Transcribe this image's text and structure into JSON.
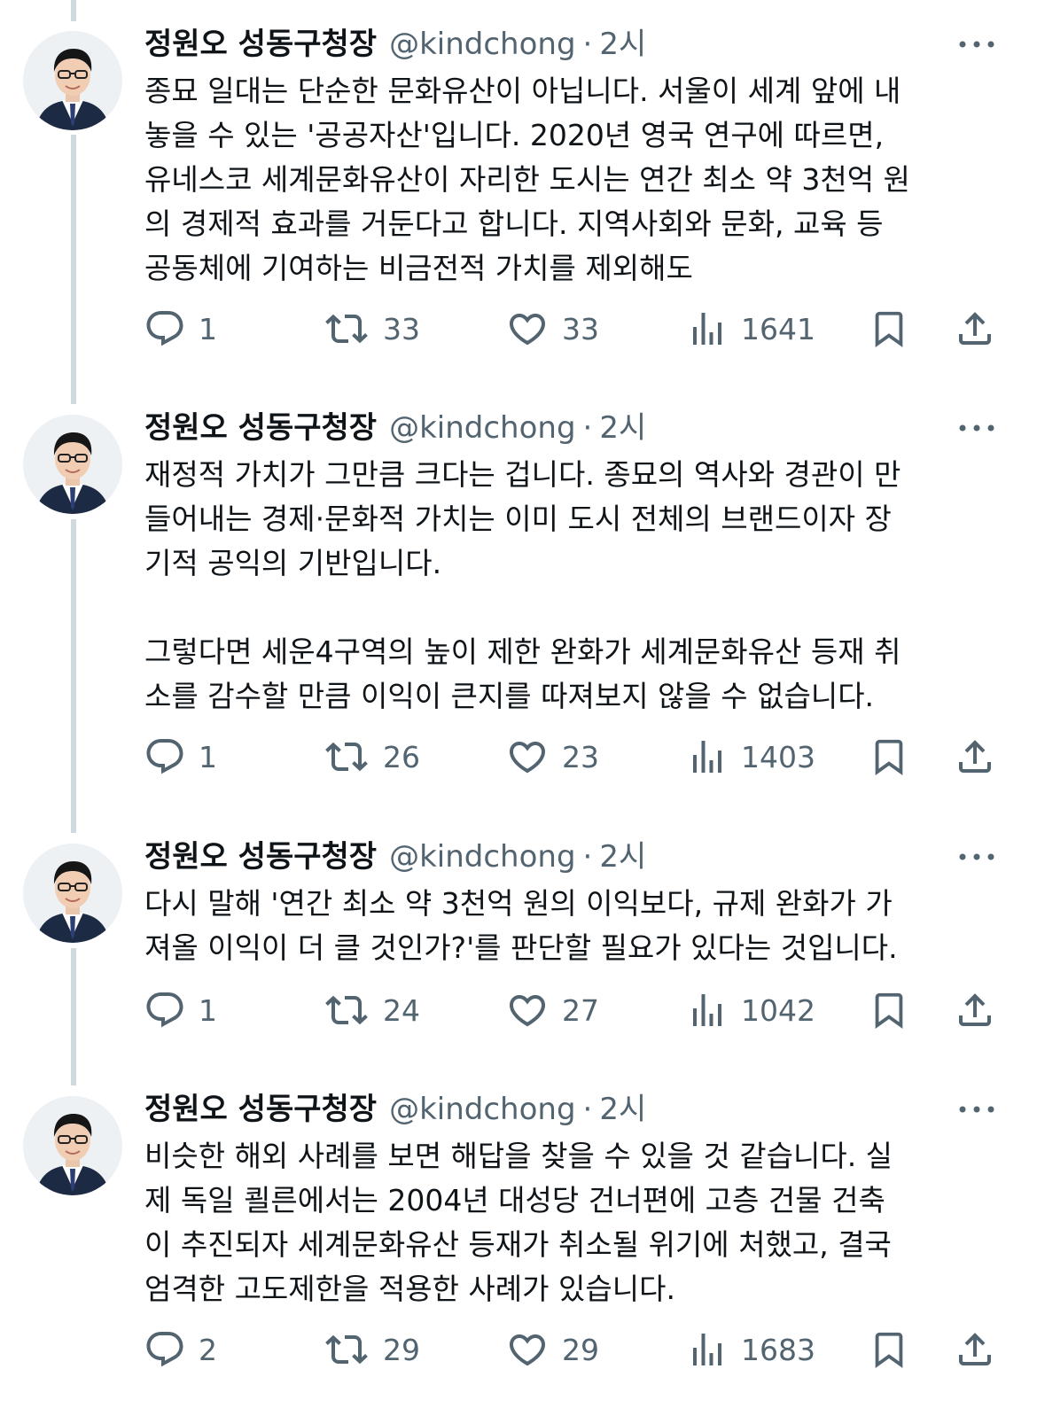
{
  "tweets": [
    {
      "author_name": "정원오 성동구청장",
      "author_handle": "@kindchong",
      "separator": "·",
      "time": "2시",
      "text": "종묘 일대는 단순한 문화유산이 아닙니다. 서울이 세계 앞에 내\n놓을 수 있는 '공공자산'입니다. 2020년 영국 연구에 따르면,\n유네스코 세계문화유산이 자리한 도시는 연간 최소 약 3천억 원\n의 경제적 효과를 거둔다고 합니다. 지역사회와 문화, 교육 등\n공동체에 기여하는 비금전적 가치를 제외해도",
      "replies": "1",
      "retweets": "33",
      "likes": "33",
      "views": "1641"
    },
    {
      "author_name": "정원오 성동구청장",
      "author_handle": "@kindchong",
      "separator": "·",
      "time": "2시",
      "text": "재정적 가치가 그만큼 크다는 겁니다. 종묘의 역사와 경관이 만\n들어내는 경제·문화적 가치는 이미 도시 전체의 브랜드이자 장\n기적 공익의 기반입니다.\n\n그렇다면 세운4구역의 높이 제한 완화가 세계문화유산 등재 취\n소를 감수할 만큼 이익이 큰지를 따져보지 않을 수 없습니다.",
      "replies": "1",
      "retweets": "26",
      "likes": "23",
      "views": "1403"
    },
    {
      "author_name": "정원오 성동구청장",
      "author_handle": "@kindchong",
      "separator": "·",
      "time": "2시",
      "text": "다시 말해 '연간 최소 약 3천억 원의 이익보다, 규제 완화가 가\n져올 이익이 더 클 것인가?'를 판단할 필요가 있다는 것입니다.",
      "replies": "1",
      "retweets": "24",
      "likes": "27",
      "views": "1042"
    },
    {
      "author_name": "정원오 성동구청장",
      "author_handle": "@kindchong",
      "separator": "·",
      "time": "2시",
      "text": "비슷한 해외 사례를 보면 해답을 찾을 수 있을 것 같습니다. 실\n제 독일 쾰른에서는 2004년 대성당 건너편에 고층 건물 건축\n이 추진되자 세계문화유산 등재가 취소될 위기에 처했고, 결국\n엄격한 고도제한을 적용한 사례가 있습니다.",
      "replies": "2",
      "retweets": "29",
      "likes": "29",
      "views": "1683"
    }
  ],
  "icons": {
    "reply": "reply-icon",
    "retweet": "retweet-icon",
    "like": "like-icon",
    "views": "views-icon",
    "bookmark": "bookmark-icon",
    "share": "share-icon",
    "more": "more-icon"
  },
  "colors": {
    "text": "#0f1419",
    "secondary": "#536471",
    "thread_line": "#cfd9de"
  }
}
